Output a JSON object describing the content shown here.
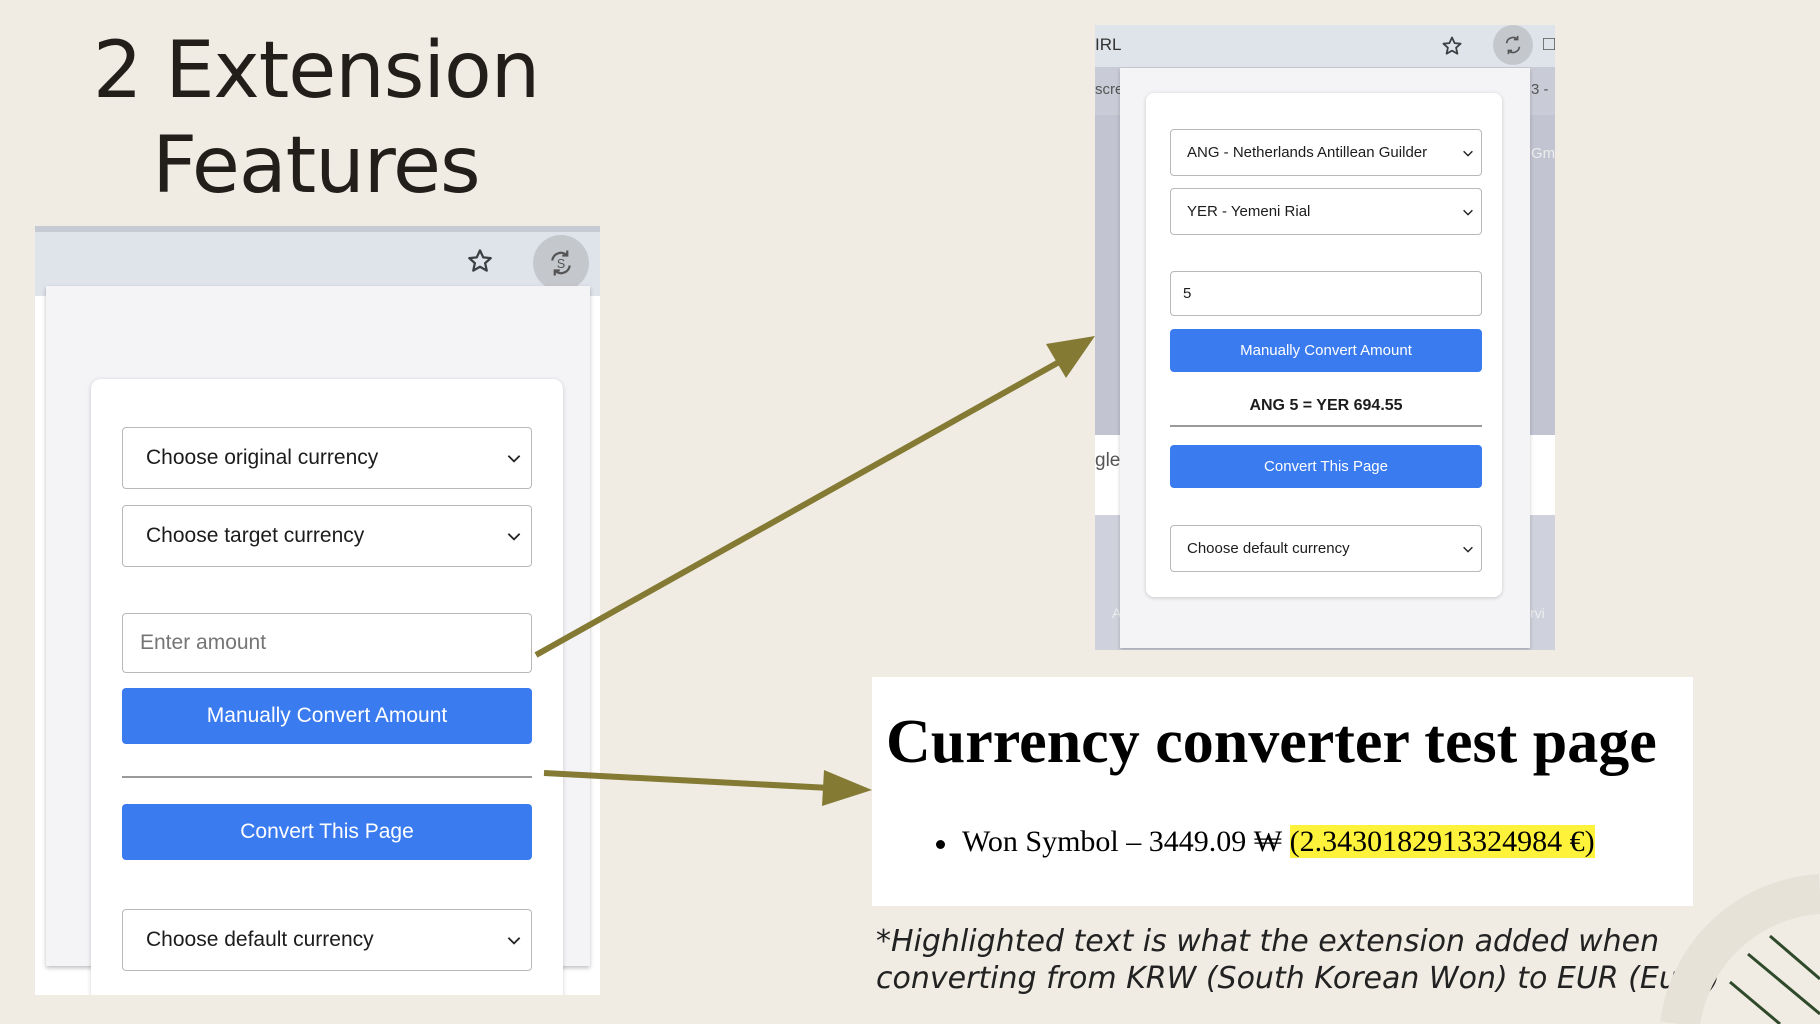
{
  "slide": {
    "title_line1": "2 Extension",
    "title_line2": "Features",
    "caption": "*Highlighted text is what the extension added when converting from KRW (South Korean Won) to EUR (Euro)",
    "accent_color": "#857a34"
  },
  "popup_left": {
    "original_currency": "Choose original currency",
    "target_currency": "Choose target currency",
    "amount_placeholder": "Enter amount",
    "manual_convert": "Manually Convert Amount",
    "convert_page": "Convert This Page",
    "default_currency": "Choose default currency",
    "button_color": "#3a7bf0"
  },
  "popup_right": {
    "url_fragment": "IRL",
    "bg_text_1": "scre",
    "bg_text_2": "3 -",
    "bg_text_3": "Gm",
    "bg_text_4": "gle",
    "bg_text_5": "A",
    "bg_text_6": "rvi",
    "original_currency": "ANG - Netherlands Antillean Guilder",
    "target_currency": "YER - Yemeni Rial",
    "amount_value": "5",
    "manual_convert": "Manually Convert Amount",
    "result": "ANG 5 = YER 694.55",
    "convert_page": "Convert This Page",
    "default_currency": "Choose default currency"
  },
  "test_page": {
    "title": "Currency converter test page",
    "item_text": "Won Symbol – 3449.09 ₩ ",
    "item_highlight": "(2.3430182913324984 €)",
    "highlight_color": "#fff23a"
  }
}
